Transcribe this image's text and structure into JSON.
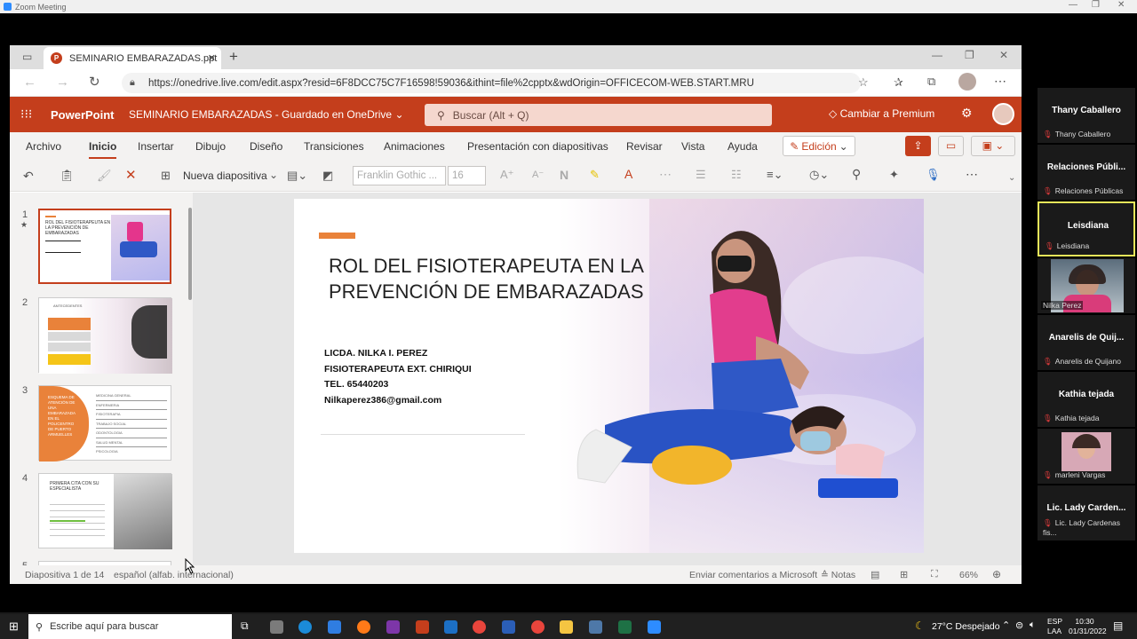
{
  "zoom": {
    "window_title": "Zoom Meeting"
  },
  "browser": {
    "tab_title": "SEMINARIO EMBARAZADAS.ppt",
    "url": "https://onedrive.live.com/edit.aspx?resid=6F8DCC75C7F16598!59036&ithint=file%2cpptx&wdOrigin=OFFICECOM-WEB.START.MRU"
  },
  "ppt": {
    "app_name": "PowerPoint",
    "doc_title": "SEMINARIO EMBARAZADAS  -  Guardado en OneDrive",
    "search_placeholder": "Buscar (Alt + Q)",
    "premium": "Cambiar a Premium",
    "tabs": [
      "Archivo",
      "Inicio",
      "Insertar",
      "Dibujo",
      "Diseño",
      "Transiciones",
      "Animaciones",
      "Presentación con diapositivas",
      "Revisar",
      "Vista",
      "Ayuda"
    ],
    "edit_mode": "Edición",
    "new_slide": "Nueva diapositiva",
    "font_name": "Franklin Gothic ...",
    "font_size": "16"
  },
  "slide": {
    "title_line1": "ROL DEL FISIOTERAPEUTA EN LA",
    "title_line2": "PREVENCIÓN DE EMBARAZADAS",
    "line1": "LICDA. NILKA I. PEREZ",
    "line2": "FISIOTERAPEUTA EXT. CHIRIQUI",
    "line3": "TEL. 65440203",
    "line4": "Nilkaperez386@gmail.com"
  },
  "thumbnails": {
    "numbers": [
      "1",
      "2",
      "3",
      "4",
      "5"
    ],
    "t1_title": "ROL DEL FISIOTERAPEUTA EN LA PREVENCIÓN DE EMBARAZADAS",
    "t2_title": "ANTECEDENTES",
    "t3_left": "ESQUEMA DE ATENCIÓN DE UNA EMBARAZADA EN EL POLICENTRO DE PUERTO ARMUELLES",
    "t3_items": [
      "MEDICINA GENERAL",
      "ENFERMERIA",
      "FISIOTERAPIA",
      "TRABAJO SOCIAL",
      "ODONTOLOGIA",
      "SALUD MENTAL",
      "PSICOLOGIA"
    ],
    "t4_title": "PRIMERA CITA CON SU ESPECIALISTA"
  },
  "status": {
    "slide_info": "Diapositiva 1 de 14",
    "language": "español (alfab. internacional)",
    "feedback": "Enviar comentarios a Microsoft",
    "notes": "Notas",
    "zoom": "66%"
  },
  "participants": [
    {
      "name": "Thany Caballero",
      "sub": "Thany Caballero"
    },
    {
      "name": "Relaciones Públi...",
      "sub": "Relaciones Públicas"
    },
    {
      "name": "Leisdiana",
      "sub": "Leisdiana"
    },
    {
      "name": "",
      "sub": "Nilka Perez"
    },
    {
      "name": "Anarelis de Quij...",
      "sub": "Anarelis de Quijano"
    },
    {
      "name": "Kathia tejada",
      "sub": "Kathia tejada"
    },
    {
      "name": "",
      "sub": "marleni Vargas"
    },
    {
      "name": "Lic. Lady Carden...",
      "sub": "Lic. Lady Cardenas fis..."
    }
  ],
  "taskbar": {
    "search_placeholder": "Escribe aquí para buscar",
    "weather": "27°C  Despejado",
    "lang1": "ESP",
    "lang2": "LAA",
    "time": "10:30",
    "date": "01/31/2022"
  },
  "colors": {
    "ppt_accent": "#c43e1c",
    "active_speaker": "#e6e65a",
    "slide_accent": "#e9823a"
  }
}
